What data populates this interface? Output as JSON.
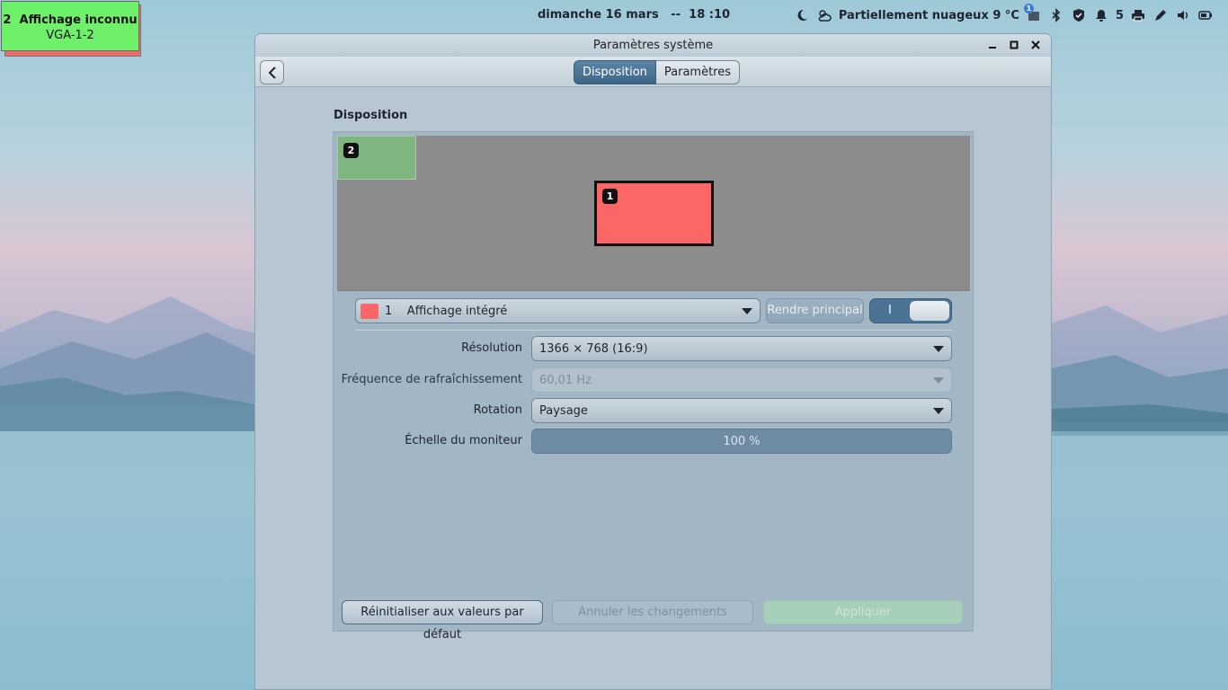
{
  "topbar": {
    "clock": "dimanche 16 mars   --  18 :10",
    "weather": "Partiellement nuageux 9 °C",
    "notif_badge": "1",
    "notification_count": "5",
    "icons": [
      "night-mode-icon",
      "weather-icon",
      "notification-icon",
      "bluetooth-icon",
      "shield-icon",
      "bell-icon",
      "printer-icon",
      "pen-icon",
      "volume-icon",
      "battery-icon"
    ]
  },
  "display_label": {
    "title": "2  Affichage inconnu",
    "connector": "VGA-1-2",
    "colors": {
      "front": "#6ef06a",
      "back": "#f06a6a"
    }
  },
  "window": {
    "title": "Paramètres système",
    "tabs": [
      {
        "label": "Disposition",
        "active": true
      },
      {
        "label": "Paramètres",
        "active": false
      }
    ]
  },
  "layout_section": {
    "title": "Disposition",
    "monitors": [
      {
        "number": "1",
        "color": "#fd6666"
      },
      {
        "number": "2",
        "color": "#7fb57e"
      }
    ]
  },
  "monitor_selector": {
    "value": "1    Affichage intégré",
    "make_primary": "Rendre principal",
    "toggle_label": "I"
  },
  "settings": {
    "resolution": {
      "label": "Résolution",
      "value": "1366 × 768 (16:9)"
    },
    "refresh": {
      "label": "Fréquence de rafraîchissement",
      "value": "60,01 Hz"
    },
    "rotation": {
      "label": "Rotation",
      "value": "Paysage"
    },
    "scale": {
      "label": "Échelle du moniteur",
      "value": "100 %"
    }
  },
  "buttons": {
    "reset": "Réinitialiser aux valeurs par défaut",
    "cancel": "Annuler les changements",
    "apply": "Appliquer"
  }
}
